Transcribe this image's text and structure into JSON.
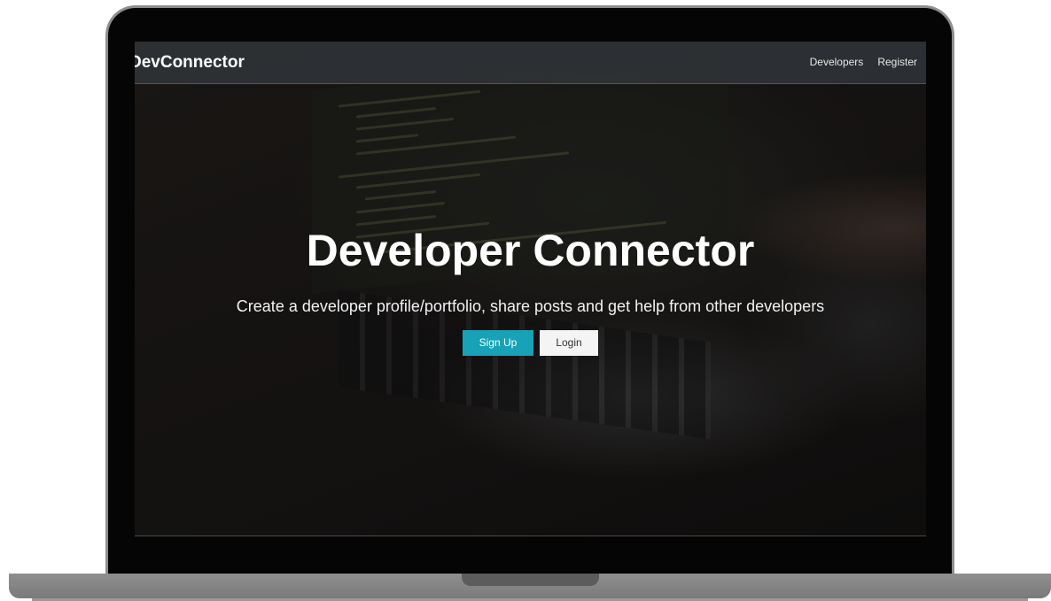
{
  "app": {
    "brand": "DevConnector"
  },
  "nav": {
    "links": [
      "Developers",
      "Register"
    ]
  },
  "landing": {
    "title": "Developer Connector",
    "lead": "Create a developer profile/portfolio, share posts and get help from other developers",
    "buttons": {
      "signup": "Sign Up",
      "login": "Login"
    }
  },
  "colors": {
    "primary": "#17a2b8",
    "light": "#f4f4f4",
    "navbar": "#343a40"
  }
}
